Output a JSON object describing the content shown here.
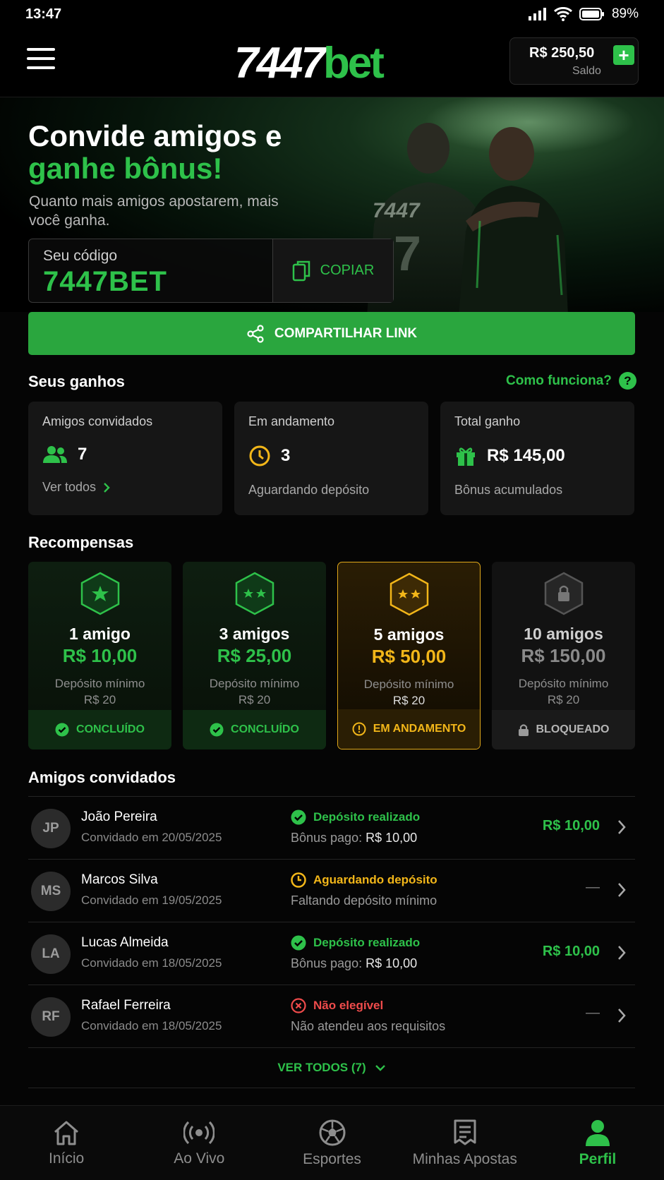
{
  "status_bar": {
    "time": "13:47",
    "battery": "89%"
  },
  "header": {
    "logo_white": "7447",
    "logo_green": "bet",
    "balance": "R$ 250,50",
    "balance_label": "Saldo",
    "add_symbol": "+"
  },
  "hero": {
    "title_line1": "Convide amigos e",
    "title_line2": "ganhe bônus!",
    "subtitle": "Quanto mais amigos apostarem, mais você ganha.",
    "jersey_number_text": "7447",
    "jersey_digit": "7",
    "code_label": "Seu código",
    "code_value": "7447BET",
    "copy_label": "COPIAR"
  },
  "share_label": "COMPARTILHAR LINK",
  "earnings": {
    "title": "Seus ganhos",
    "help_link": "Como funciona?",
    "help_symbol": "?",
    "cards": [
      {
        "title": "Amigos convidados",
        "value": "7",
        "footer": "Ver todos",
        "icon": "users-icon"
      },
      {
        "title": "Em andamento",
        "value": "3",
        "footer": "Aguardando depósito",
        "icon": "clock-icon"
      },
      {
        "title": "Total ganho",
        "value": "R$ 145,00",
        "footer": "Bônus acumulados",
        "icon": "gift-icon"
      }
    ]
  },
  "rewards": {
    "title": "Recompensas",
    "items": [
      {
        "friends": "1 amigo",
        "value": "R$ 10,00",
        "min_label": "Depósito mínimo",
        "min": "R$ 20",
        "status": "CONCLUÍDO"
      },
      {
        "friends": "3 amigos",
        "value": "R$ 25,00",
        "min_label": "Depósito mínimo",
        "min": "R$ 20",
        "status": "CONCLUÍDO"
      },
      {
        "friends": "5 amigos",
        "value": "R$ 50,00",
        "min_label": "Depósito mínimo",
        "min": "R$ 20",
        "status": "EM ANDAMENTO"
      },
      {
        "friends": "10 amigos",
        "value": "R$ 150,00",
        "min_label": "Depósito mínimo",
        "min": "R$ 20",
        "status": "BLOQUEADO"
      }
    ],
    "colors": {
      "done": "#2ec14a",
      "progress": "#f2b619",
      "locked": "#8a8a8a"
    }
  },
  "friends": {
    "title": "Amigos convidados",
    "list": [
      {
        "initials": "JP",
        "name": "João Pereira",
        "date": "Convidado em 20/05/2025",
        "status": "Depósito realizado",
        "detail_prefix": "Bônus pago:",
        "detail_value": "R$ 10,00",
        "amount": "R$ 10,00",
        "kind": "ok"
      },
      {
        "initials": "MS",
        "name": "Marcos Silva",
        "date": "Convidado em 19/05/2025",
        "status": "Aguardando depósito",
        "detail_prefix": "Faltando depósito mínimo",
        "detail_value": "",
        "amount": "—",
        "kind": "wait"
      },
      {
        "initials": "LA",
        "name": "Lucas Almeida",
        "date": "Convidado em 18/05/2025",
        "status": "Depósito realizado",
        "detail_prefix": "Bônus pago:",
        "detail_value": "R$ 10,00",
        "amount": "R$ 10,00",
        "kind": "ok"
      },
      {
        "initials": "RF",
        "name": "Rafael Ferreira",
        "date": "Convidado em 18/05/2025",
        "status": "Não elegível",
        "detail_prefix": "Não atendeu aos requisitos",
        "detail_value": "",
        "amount": "—",
        "kind": "no"
      }
    ],
    "see_all": "VER TODOS (7)"
  },
  "nav": [
    {
      "label": "Início",
      "icon": "home-icon"
    },
    {
      "label": "Ao Vivo",
      "icon": "live-icon"
    },
    {
      "label": "Esportes",
      "icon": "soccer-ball-icon"
    },
    {
      "label": "Minhas Apostas",
      "icon": "bet-slip-icon"
    },
    {
      "label": "Perfil",
      "icon": "user-icon",
      "active": true
    }
  ]
}
